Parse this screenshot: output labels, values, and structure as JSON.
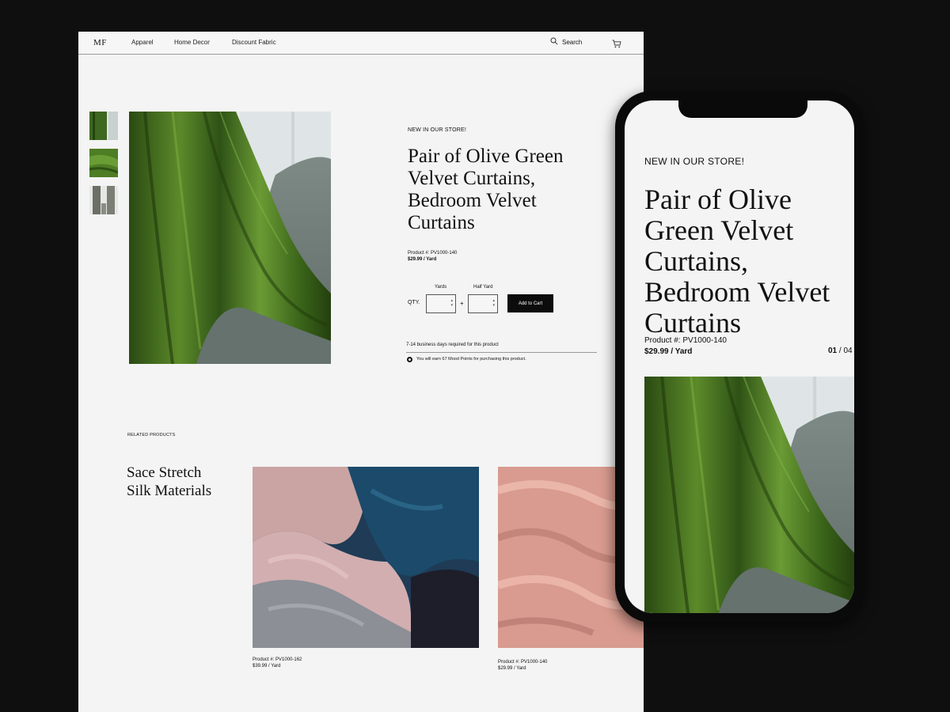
{
  "nav": {
    "logo": "MF",
    "links": [
      "Apparel",
      "Home Decor",
      "Discount Fabric"
    ],
    "search_label": "Search"
  },
  "product": {
    "eyebrow": "NEW IN OUR STORE!",
    "title": "Pair of Olive Green Velvet Curtains, Bedroom Velvet Curtains",
    "product_number": "Product #: PV1000-140",
    "price": "$29.99 / Yard",
    "qty_label": "QTY.",
    "yards_label": "Yards",
    "half_yard_label": "Half Yard",
    "plus": "+",
    "add_to_cart": "Add to Cart",
    "delivery": "7-14 business days required for this product",
    "points": "You will earn 67 Mood Points for purchasing this product."
  },
  "related": {
    "label": "RELATED PRODUCTS",
    "title": "Sace Stretch Silk Materials",
    "items": [
      {
        "product_number": "Product #: PV1000-162",
        "price": "$39.99 / Yard"
      },
      {
        "product_number": "Product #: PV1000-140",
        "price": "$29.99 / Yard"
      }
    ]
  },
  "mobile": {
    "eyebrow": "NEW IN OUR STORE!",
    "title": "Pair of Olive Green Velvet Curtains, Bedroom Velvet Curtains",
    "product_number": "Product #: PV1000-140",
    "price": "$29.99 / Yard",
    "pager_current": "01",
    "pager_sep": " / ",
    "pager_total": "04"
  },
  "colors": {
    "background": "#0f0f0f",
    "page": "#f4f4f4",
    "velvet_green": "#3f6a1f",
    "chair_grey": "#6f7a76",
    "accent_button": "#0c0c0c"
  }
}
